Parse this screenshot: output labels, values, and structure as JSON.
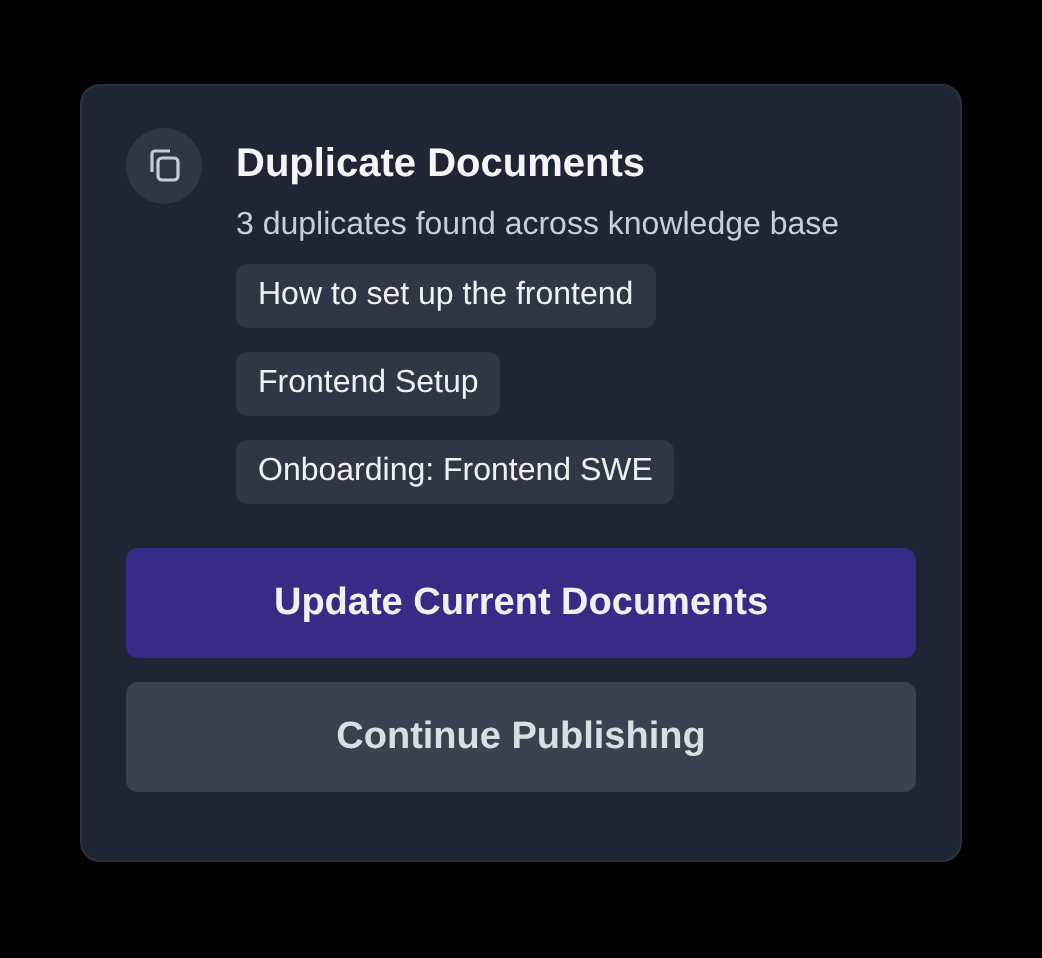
{
  "dialog": {
    "title": "Duplicate Documents",
    "subtitle": "3 duplicates found across knowledge base",
    "documents": [
      "How to set up the frontend",
      "Frontend Setup",
      "Onboarding: Frontend SWE"
    ],
    "buttons": [
      {
        "label": "Update Current Documents",
        "kind": "primary"
      },
      {
        "label": "Continue Publishing",
        "kind": "secondary"
      }
    ]
  }
}
